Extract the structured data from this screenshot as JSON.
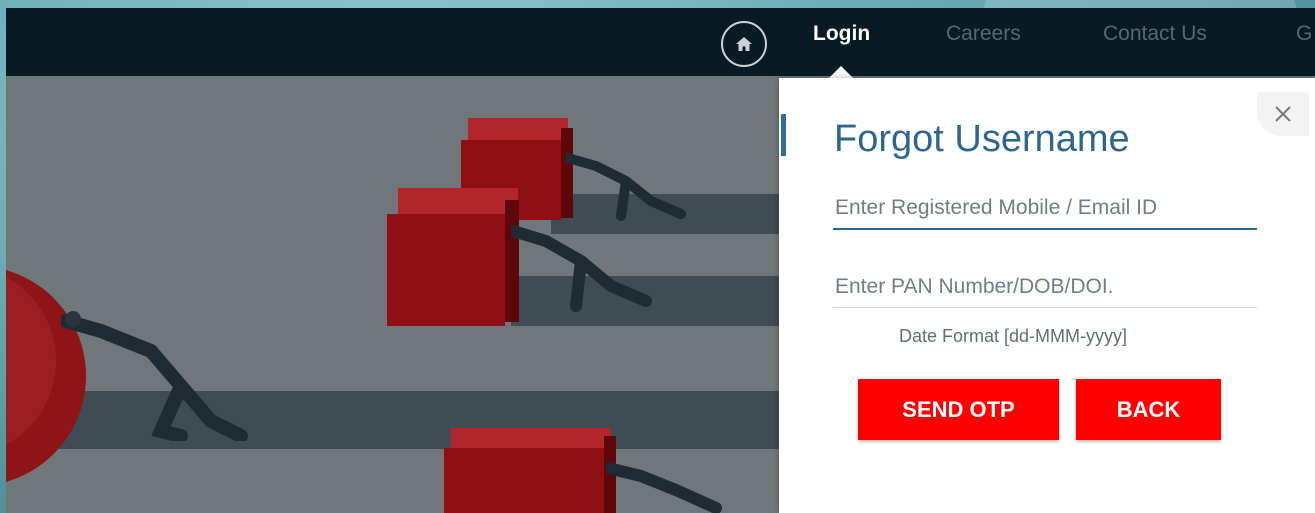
{
  "nav": {
    "home_icon": "home-icon",
    "links": [
      {
        "label": "Login"
      },
      {
        "label": "Careers"
      },
      {
        "label": "Contact Us"
      },
      {
        "label": "G"
      }
    ]
  },
  "modal": {
    "title": "Forgot Username",
    "close_icon": "close-icon",
    "fields": {
      "mobile_email_placeholder": "Enter Registered Mobile / Email ID",
      "pan_dob_placeholder": "Enter PAN Number/DOB/DOI."
    },
    "date_hint": "Date Format [dd-MMM-yyyy]",
    "buttons": {
      "send_otp": "SEND OTP",
      "back": "BACK"
    }
  },
  "colors": {
    "accent_blue": "#2d6790",
    "button_red": "#ff0000",
    "navbar": "#081a24"
  }
}
